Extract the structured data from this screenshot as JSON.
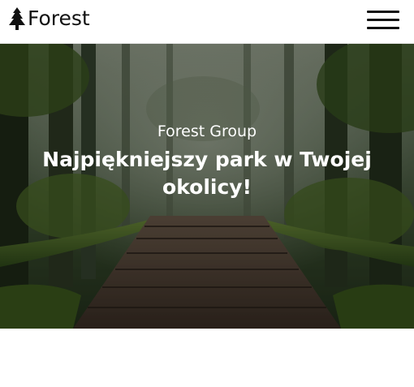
{
  "navbar": {
    "brand": {
      "icon": "pine-tree-icon",
      "label": "Forest"
    },
    "menu_icon": "hamburger-menu-icon"
  },
  "hero": {
    "subtitle": "Forest Group",
    "title": "Najpiękniejszy park w Twojej okolicy!",
    "background": "forest-boardwalk-photo"
  },
  "colors": {
    "text_dark": "#111111",
    "hero_text": "#ffffff",
    "page_bg": "#ffffff"
  }
}
